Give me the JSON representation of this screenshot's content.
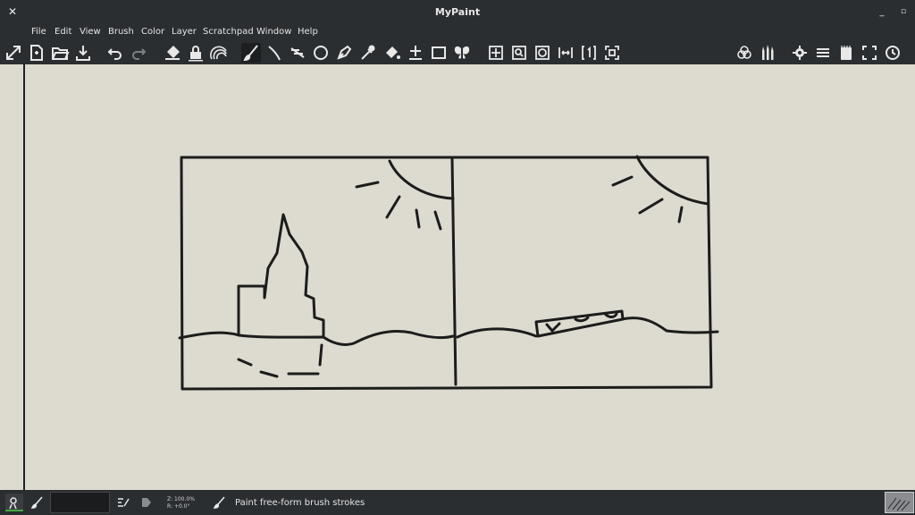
{
  "window": {
    "title": "MyPaint"
  },
  "menu": [
    "File",
    "Edit",
    "View",
    "Brush",
    "Color",
    "Layer",
    "Scratchpad",
    "Window",
    "Help"
  ],
  "toolbar": {
    "tools": [
      "fullscreen-icon",
      "new-document-icon",
      "open-document-icon",
      "save-icon",
      "undo-icon",
      "redo-icon",
      "eraser-icon",
      "lock-alpha-icon",
      "colorize-icon",
      "freehand-brush-icon",
      "inking-icon",
      "line-icon",
      "ellipse-icon",
      "pen-icon",
      "color-picker-icon",
      "fill-icon",
      "move-layer-icon",
      "frame-icon",
      "symmetry-icon",
      "pan-view-icon",
      "zoom-view-icon",
      "rotate-view-icon",
      "mirror-view-icon",
      "reset-view-icon",
      "fit-view-icon",
      "color-wheel-icon",
      "brushes-icon",
      "preferences-icon",
      "layers-icon",
      "scratchpad-icon",
      "fullscreen-toggle-icon",
      "history-icon"
    ]
  },
  "status": {
    "zoom": "Z: 100.0%",
    "rotation": "R: +0.0°",
    "message": "Paint free-form brush strokes"
  }
}
